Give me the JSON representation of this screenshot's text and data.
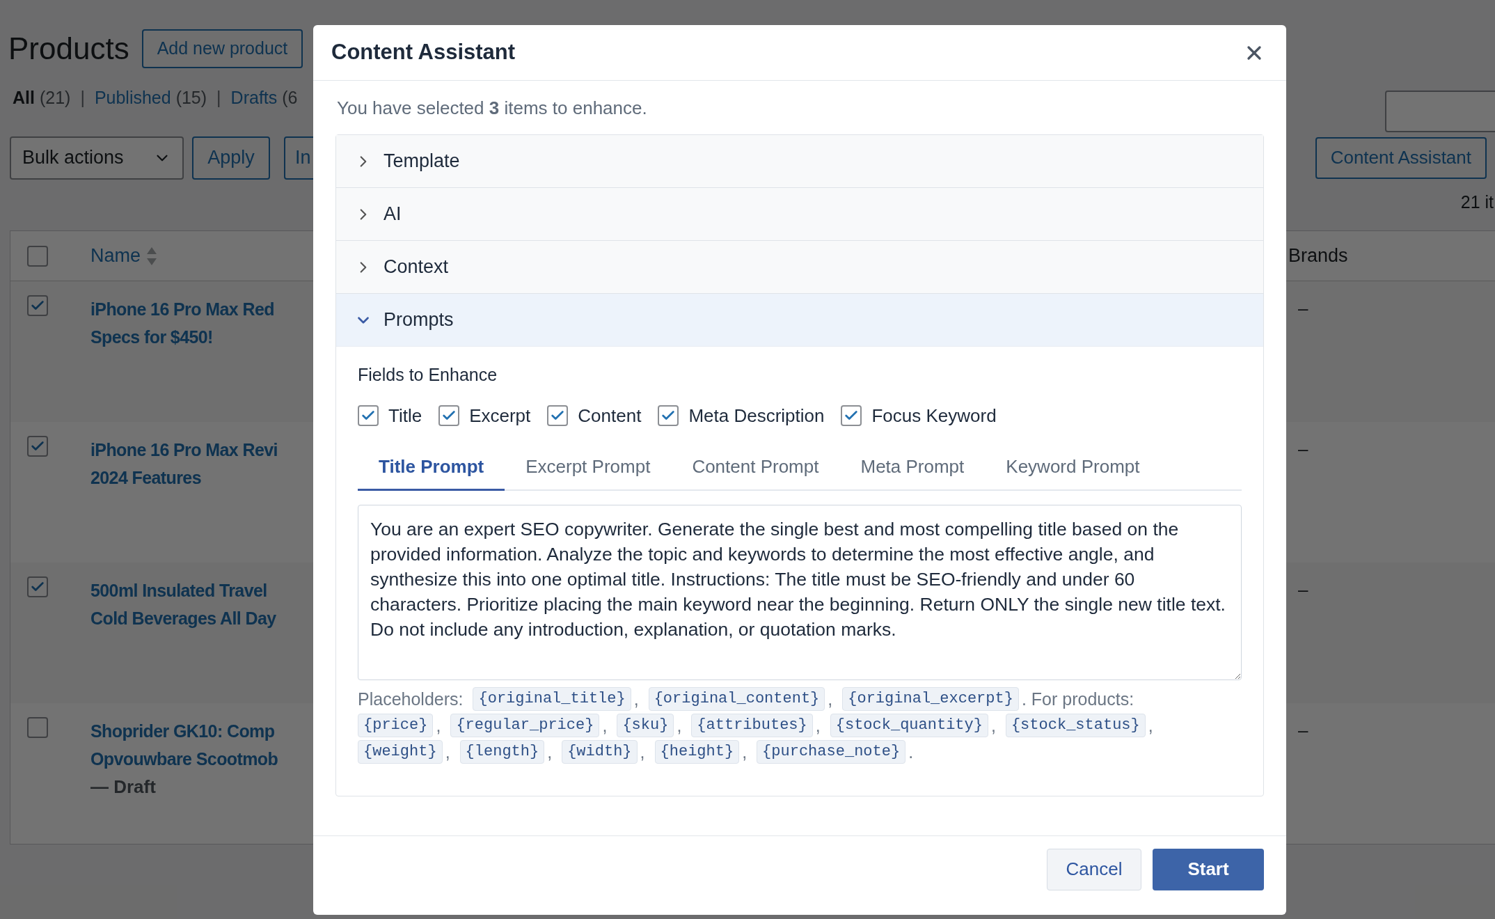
{
  "page": {
    "title": "Products",
    "add_button": "Add new product",
    "filters": [
      {
        "label": "All",
        "count": "(21)",
        "selected": true
      },
      {
        "label": "Published",
        "count": "(15)",
        "selected": false
      },
      {
        "label": "Drafts",
        "count": "(6",
        "selected": false
      }
    ],
    "filter_separator": "|",
    "bulk_actions": "Bulk actions",
    "apply_button": "Apply",
    "button_3": "In",
    "content_assistant_button": "Content Assistant",
    "items_count": "21 it",
    "table": {
      "columns": [
        "Name",
        "Brands"
      ],
      "header_checked": false,
      "rows": [
        {
          "checked": true,
          "title_lines": [
            "iPhone 16 Pro Max Red",
            "Specs for $450!"
          ],
          "brands": "–"
        },
        {
          "checked": true,
          "title_lines": [
            "iPhone 16 Pro Max Revi",
            "2024 Features"
          ],
          "brands": "–"
        },
        {
          "checked": true,
          "title_lines": [
            "500ml Insulated Travel",
            "Cold Beverages All Day"
          ],
          "brands": "–"
        },
        {
          "checked": false,
          "title_lines": [
            "Shoprider GK10: Comp",
            "Opvouwbare Scootmob"
          ],
          "status": "— Draft",
          "brands": "–"
        }
      ]
    }
  },
  "modal": {
    "title": "Content Assistant",
    "intro": "You have selected **3** items to enhance.",
    "sections": [
      {
        "label": "Template",
        "expanded": false
      },
      {
        "label": "AI",
        "expanded": false
      },
      {
        "label": "Context",
        "expanded": false
      },
      {
        "label": "Prompts",
        "expanded": true
      }
    ],
    "fields_label": "Fields to Enhance",
    "fields": [
      {
        "label": "Title",
        "checked": true
      },
      {
        "label": "Excerpt",
        "checked": true
      },
      {
        "label": "Content",
        "checked": true
      },
      {
        "label": "Meta Description",
        "checked": true
      },
      {
        "label": "Focus Keyword",
        "checked": true
      }
    ],
    "tabs": [
      {
        "label": "Title Prompt",
        "selected": true
      },
      {
        "label": "Excerpt Prompt",
        "selected": false
      },
      {
        "label": "Content Prompt",
        "selected": false
      },
      {
        "label": "Meta Prompt",
        "selected": false
      },
      {
        "label": "Keyword Prompt",
        "selected": false
      }
    ],
    "prompt": "You are an expert SEO copywriter. Generate the single best and most compelling title based on the provided information. Analyze the topic and keywords to determine the most effective angle, and synthesize this into one optimal title. Instructions: The title must be SEO-friendly and under 60 characters. Prioritize placing the main keyword near the beginning. Return ONLY the single new title text. Do not include any introduction, explanation, or quotation marks.",
    "placeholder_lines": [
      [
        {
          "kind": "text",
          "text": "Placeholders:"
        },
        {
          "kind": "code",
          "text": "{original_title}"
        },
        {
          "kind": "text",
          "text": ","
        },
        {
          "kind": "code",
          "text": "{original_content}"
        },
        {
          "kind": "text",
          "text": ","
        },
        {
          "kind": "code",
          "text": "{original_excerpt}"
        },
        {
          "kind": "text",
          "text": ". For products:"
        }
      ],
      [
        {
          "kind": "code",
          "text": "{price}"
        },
        {
          "kind": "text",
          "text": ","
        },
        {
          "kind": "code",
          "text": "{regular_price}"
        },
        {
          "kind": "text",
          "text": ","
        },
        {
          "kind": "code",
          "text": "{sku}"
        },
        {
          "kind": "text",
          "text": ","
        },
        {
          "kind": "code",
          "text": "{attributes}"
        },
        {
          "kind": "text",
          "text": ","
        },
        {
          "kind": "code",
          "text": "{stock_quantity}"
        },
        {
          "kind": "text",
          "text": ","
        },
        {
          "kind": "code",
          "text": "{stock_status}"
        },
        {
          "kind": "text",
          "text": ","
        }
      ],
      [
        {
          "kind": "code",
          "text": "{weight}"
        },
        {
          "kind": "text",
          "text": ","
        },
        {
          "kind": "code",
          "text": "{length}"
        },
        {
          "kind": "text",
          "text": ","
        },
        {
          "kind": "code",
          "text": "{width}"
        },
        {
          "kind": "text",
          "text": ","
        },
        {
          "kind": "code",
          "text": "{height}"
        },
        {
          "kind": "text",
          "text": ","
        },
        {
          "kind": "code",
          "text": "{purchase_note}"
        },
        {
          "kind": "text",
          "text": "."
        }
      ]
    ],
    "cancel_button": "Cancel",
    "start_button": "Start"
  }
}
